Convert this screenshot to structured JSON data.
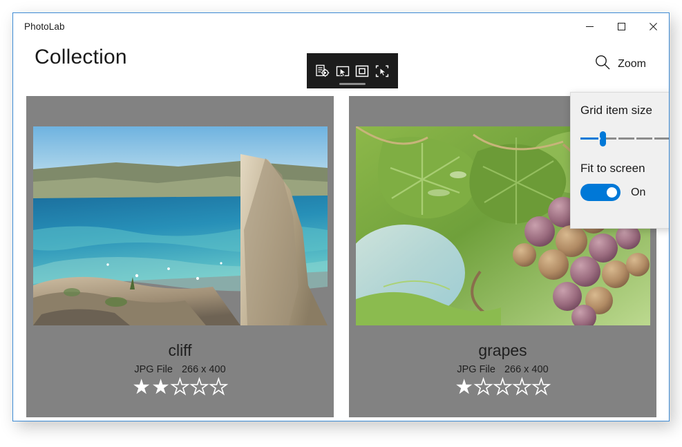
{
  "window": {
    "app_title": "PhotoLab",
    "caption": {
      "minimize_label": "Minimize",
      "maximize_label": "Maximize",
      "close_label": "Close"
    },
    "border_color": "#3c8ad4"
  },
  "header": {
    "page_title": "Collection",
    "zoom_command_label": "Zoom"
  },
  "capture_toolbar": {
    "background_color": "#1c1c1c",
    "buttons": [
      {
        "name": "capture-settings-icon",
        "tooltip": "Capture settings"
      },
      {
        "name": "select-window-icon",
        "tooltip": "Select window"
      },
      {
        "name": "select-region-icon",
        "tooltip": "Select region"
      },
      {
        "name": "select-element-icon",
        "tooltip": "Select element"
      }
    ]
  },
  "zoom_flyout": {
    "grid_item_size_label": "Grid item size",
    "slider": {
      "value_percent": 25,
      "min": 0,
      "max": 100,
      "tick_count": 5,
      "accent_color": "#0078d7",
      "track_color": "#8c8c8c"
    },
    "fit_to_screen_label": "Fit to screen",
    "fit_to_screen_state": "On",
    "toggle_on_color": "#0078d7",
    "panel_background": "#f0f0f0"
  },
  "grid": {
    "card_background": "#828282",
    "rows": [
      {
        "cards": [
          {
            "name": "cliff",
            "file_type": "JPG File",
            "dimensions": "266 x 400",
            "rating": 2,
            "max_rating": 5,
            "image_alt": "coastal-cliff-photo"
          },
          {
            "name": "grapes",
            "file_type": "JPG File",
            "dimensions": "266 x 400",
            "rating": 1,
            "max_rating": 5,
            "image_alt": "grape-vine-photo"
          }
        ]
      }
    ],
    "partial_row_card_count": 2
  },
  "glyphs": {
    "star_filled": "★",
    "star_empty": "★"
  }
}
